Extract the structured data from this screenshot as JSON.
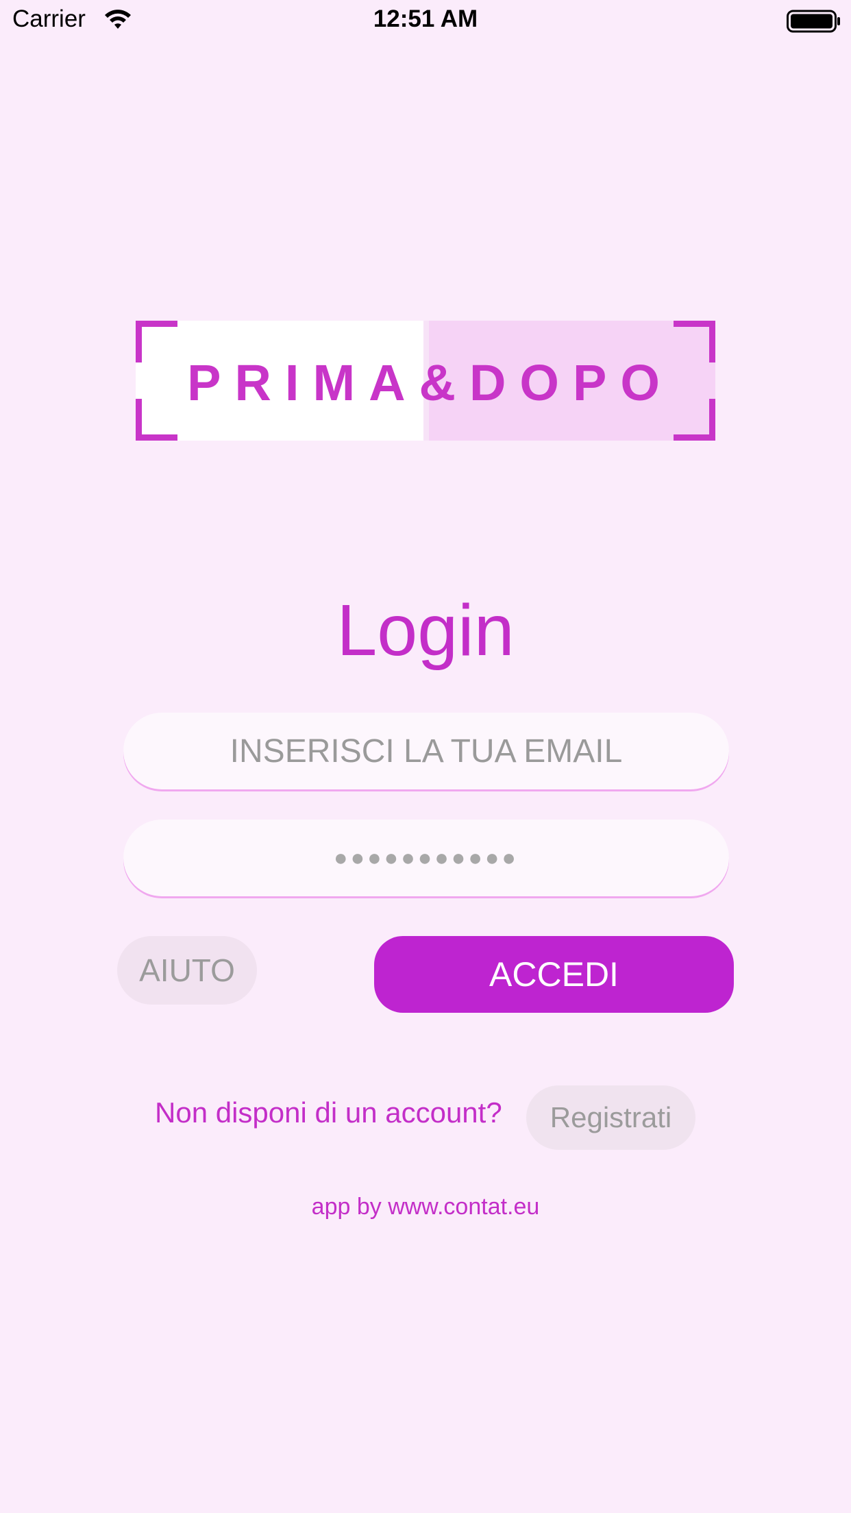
{
  "status_bar": {
    "carrier": "Carrier",
    "time": "12:51 AM",
    "icons": [
      "wifi-icon",
      "battery-icon"
    ]
  },
  "logo": {
    "text": "PRIMA&DOPO",
    "colors": {
      "accent": "#c835c8",
      "left_panel": "#ffffff",
      "right_panel": "#f6d3f6"
    }
  },
  "login": {
    "title": "Login",
    "email_placeholder": "INSERISCI LA TUA EMAIL",
    "email_value": "",
    "password_value": "●●●●●●●●●●●",
    "help_button": "AIUTO",
    "submit_button": "ACCEDI"
  },
  "register": {
    "prompt": "Non disponi di un account?",
    "button": "Registrati"
  },
  "footer": {
    "credits": "app by www.contat.eu"
  },
  "colors": {
    "background": "#fbecfb",
    "primary": "#be24d0",
    "text_accent": "#c32ec8",
    "muted_button": "#f1e2f0"
  }
}
